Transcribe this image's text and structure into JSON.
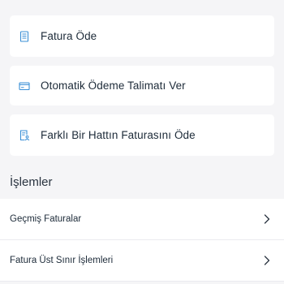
{
  "colors": {
    "accent": "#3a8fd6",
    "background": "#f5f5f7",
    "card": "#ffffff",
    "text": "#1c2a38"
  },
  "actions": [
    {
      "label": "Fatura Öde",
      "icon": "invoice-icon"
    },
    {
      "label": "Otomatik Ödeme Talimatı Ver",
      "icon": "credit-card-icon"
    },
    {
      "label": "Farklı Bir Hattın Faturasını Öde",
      "icon": "invoice-user-icon"
    }
  ],
  "section": {
    "title": "İşlemler"
  },
  "list": [
    {
      "label": "Geçmiş Faturalar",
      "icon": "chevron-right-icon"
    },
    {
      "label": "Fatura Üst Sınır İşlemleri",
      "icon": "chevron-right-icon"
    }
  ]
}
